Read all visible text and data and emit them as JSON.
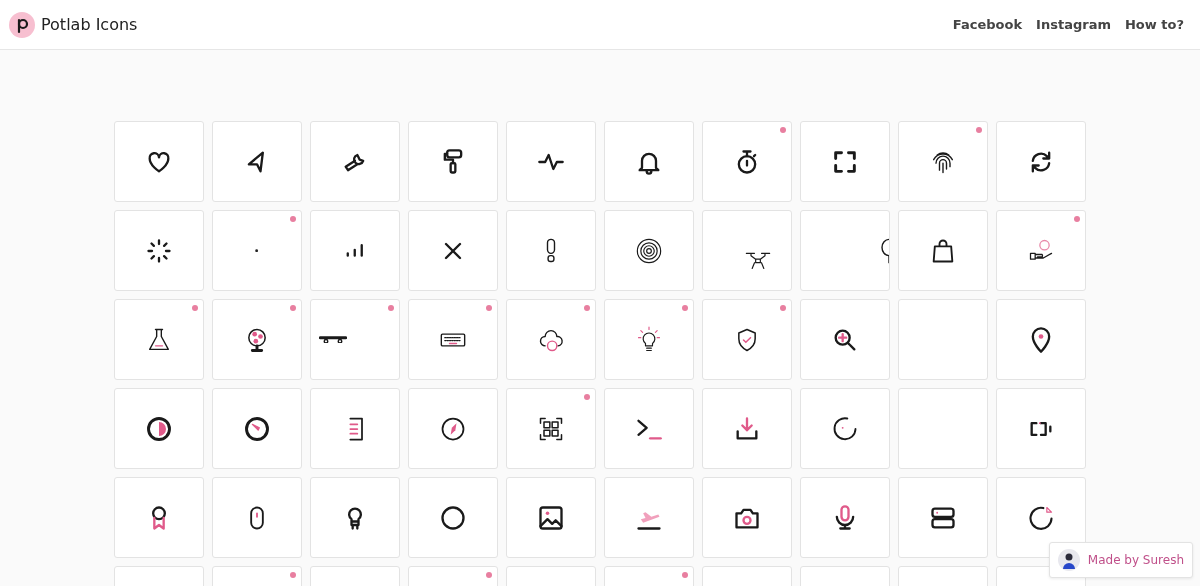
{
  "header": {
    "brand": "Potlab Icons",
    "nav": [
      "Facebook",
      "Instagram",
      "How to?"
    ]
  },
  "grid": {
    "cards": [
      {
        "new": false
      },
      {
        "new": false
      },
      {
        "new": false
      },
      {
        "new": false
      },
      {
        "new": false
      },
      {
        "new": false
      },
      {
        "new": true
      },
      {
        "new": false
      },
      {
        "new": true
      },
      {
        "new": false
      },
      {
        "new": false
      },
      {
        "new": true
      },
      {
        "new": false
      },
      {
        "new": false
      },
      {
        "new": false
      },
      {
        "new": false
      },
      {
        "new": false
      },
      {
        "new": false
      },
      {
        "new": false
      },
      {
        "new": true
      },
      {
        "new": true
      },
      {
        "new": true
      },
      {
        "new": true
      },
      {
        "new": true
      },
      {
        "new": true
      },
      {
        "new": true
      },
      {
        "new": true
      },
      {
        "new": false
      },
      {
        "new": false
      },
      {
        "new": false
      },
      {
        "new": false
      },
      {
        "new": false
      },
      {
        "new": false
      },
      {
        "new": false
      },
      {
        "new": true
      },
      {
        "new": false
      },
      {
        "new": false
      },
      {
        "new": false
      },
      {
        "new": false
      },
      {
        "new": false
      },
      {
        "new": false
      },
      {
        "new": false
      },
      {
        "new": false
      },
      {
        "new": false
      },
      {
        "new": false
      },
      {
        "new": false
      },
      {
        "new": false
      },
      {
        "new": false
      },
      {
        "new": false
      },
      {
        "new": false
      },
      {
        "new": false
      },
      {
        "new": true
      },
      {
        "new": false
      },
      {
        "new": true
      },
      {
        "new": false
      },
      {
        "new": true
      },
      {
        "new": false
      },
      {
        "new": false
      },
      {
        "new": false
      }
    ]
  },
  "credit": {
    "text": "Made by Suresh"
  }
}
